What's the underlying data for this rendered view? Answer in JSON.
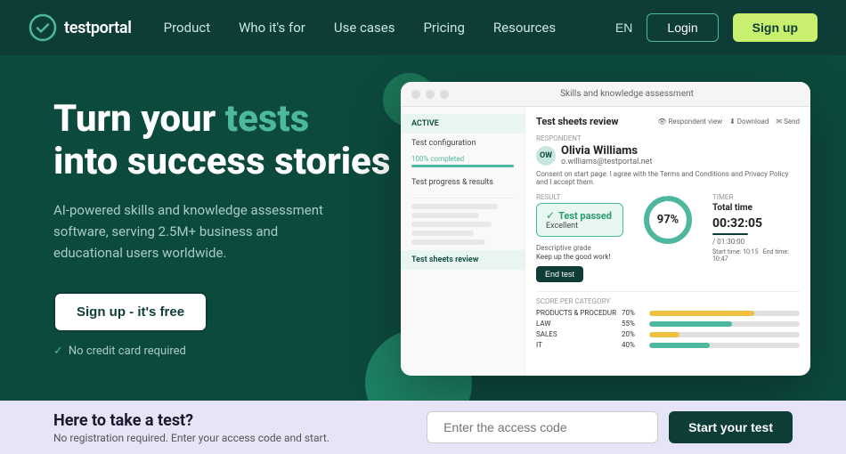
{
  "brand": {
    "name": "testportal",
    "logo_icon": "check-shield"
  },
  "navbar": {
    "links": [
      {
        "label": "Product",
        "id": "product"
      },
      {
        "label": "Who it's for",
        "id": "who"
      },
      {
        "label": "Use cases",
        "id": "usecases"
      },
      {
        "label": "Pricing",
        "id": "pricing"
      },
      {
        "label": "Resources",
        "id": "resources"
      }
    ],
    "lang": "EN",
    "login_label": "Login",
    "signup_label": "Sign up"
  },
  "hero": {
    "title_line1": "Turn your ",
    "title_highlight": "tests",
    "title_line2": "into success stories",
    "subtitle": "AI-powered skills and knowledge assessment software, serving 2.5M+ business and educational users worldwide.",
    "cta_label": "Sign up - it's free",
    "no_credit_text": "No credit card required"
  },
  "mockup": {
    "header_title": "Skills and knowledge assessment",
    "active_tab": "ACTIVE",
    "test_config_label": "Test configuration",
    "test_config_progress": "100% completed",
    "test_progress_label": "Test progress & results",
    "test_sheets_label": "Test sheets review",
    "respondent_section_label": "RESPONDENT",
    "respondent_name": "Olivia Williams",
    "respondent_email": "o.williams@testportal.net",
    "consent_text": "Consent on start page: I agree with the Terms and Conditions and Privacy Policy and I accept them.",
    "result_label": "RESULT",
    "passed_text": "Test passed",
    "grade": "Excellent",
    "desc_grade_label": "Descriptive grade",
    "desc_grade_text": "Keep up the good work!",
    "percentage": "97%",
    "percentage_value": 97,
    "timer_label": "TIMER",
    "total_time_label": "Total time",
    "timer_value": "00:32:05",
    "timer_max": "/ 01:30:00",
    "start_time_label": "Start time",
    "start_time": "10:15",
    "end_time_label": "End time",
    "end_time": "10:47",
    "end_test_label": "End test",
    "score_label": "SCORE PER CATEGORY",
    "scores": [
      {
        "name": "PRODUCTS & PROCEDURES",
        "pct": "70%",
        "value": 70,
        "color": "#f0c040"
      },
      {
        "name": "LAW",
        "pct": "55%",
        "value": 55,
        "color": "#4db89e"
      },
      {
        "name": "SALES",
        "pct": "20%",
        "value": 20,
        "color": "#f0c040"
      },
      {
        "name": "IT",
        "pct": "40%",
        "value": 40,
        "color": "#4db89e"
      }
    ]
  },
  "bottom": {
    "title": "Here to take a test?",
    "subtitle": "No registration required. Enter your access code and start.",
    "input_placeholder": "Enter the access code",
    "start_label": "Start your test"
  }
}
